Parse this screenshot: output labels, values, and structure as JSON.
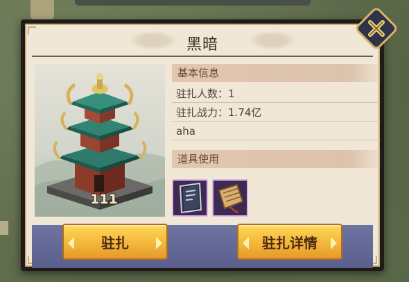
{
  "dialog": {
    "title": "黑暗",
    "close_icon": "close-x-icon"
  },
  "building": {
    "level": "111"
  },
  "basic_info": {
    "header": "基本信息",
    "troops_label": "驻扎人数：",
    "troops_value": "1",
    "power_label": "驻扎战力：",
    "power_value": "1.74亿",
    "owner": "aha"
  },
  "items": {
    "header": "道具使用",
    "slots": [
      {
        "icon": "book-icon"
      },
      {
        "icon": "scroll-icon"
      }
    ]
  },
  "actions": {
    "garrison": "驻扎",
    "garrison_details": "驻扎详情"
  },
  "colors": {
    "accent_gold": "#f3b73a",
    "band_blue": "#5b5f8e",
    "item_frame": "#e1b4e8"
  }
}
